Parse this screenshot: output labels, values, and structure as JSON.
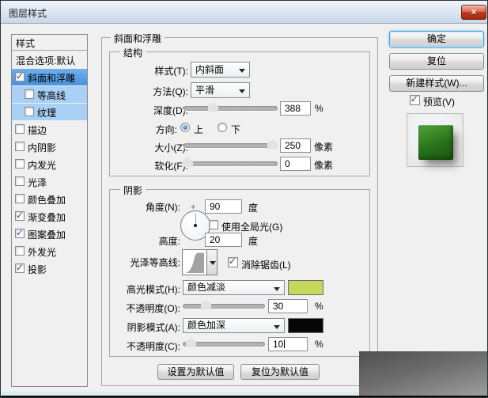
{
  "window": {
    "title": "图层样式",
    "close_glyph": "×"
  },
  "sidebar": {
    "header": "样式",
    "items": [
      {
        "label": "混合选项:默认",
        "checked": null,
        "state": "normal"
      },
      {
        "label": "斜面和浮雕",
        "checked": true,
        "state": "selected"
      },
      {
        "label": "等高线",
        "checked": false,
        "state": "highlight-sub"
      },
      {
        "label": "纹理",
        "checked": false,
        "state": "highlight-sub"
      },
      {
        "label": "描边",
        "checked": false,
        "state": "normal"
      },
      {
        "label": "内阴影",
        "checked": false,
        "state": "normal"
      },
      {
        "label": "内发光",
        "checked": false,
        "state": "normal"
      },
      {
        "label": "光泽",
        "checked": false,
        "state": "normal"
      },
      {
        "label": "颜色叠加",
        "checked": false,
        "state": "normal"
      },
      {
        "label": "渐变叠加",
        "checked": true,
        "state": "normal"
      },
      {
        "label": "图案叠加",
        "checked": true,
        "state": "normal"
      },
      {
        "label": "外发光",
        "checked": false,
        "state": "normal"
      },
      {
        "label": "投影",
        "checked": true,
        "state": "normal"
      }
    ]
  },
  "panel": {
    "legend": "斜面和浮雕",
    "structure": {
      "legend": "结构",
      "style_label": "样式(T):",
      "style_value": "内斜面",
      "method_label": "方法(Q):",
      "method_value": "平滑",
      "depth_label": "深度(D):",
      "depth_value": "388",
      "depth_unit": "%",
      "depth_slider_percent": 31,
      "direction_label": "方向:",
      "direction_up": "上",
      "direction_down": "下",
      "direction_selected": "上",
      "size_label": "大小(Z):",
      "size_value": "250",
      "size_unit": "像素",
      "size_slider_percent": 95,
      "soften_label": "软化(F):",
      "soften_value": "0",
      "soften_unit": "像素",
      "soften_slider_percent": 3
    },
    "shading": {
      "legend": "阴影",
      "angle_label": "角度(N):",
      "angle_value": "90",
      "angle_unit": "度",
      "use_global_light_label": "使用全局光(G)",
      "use_global_light_checked": false,
      "altitude_label": "高度:",
      "altitude_value": "20",
      "altitude_unit": "度",
      "gloss_contour_label": "光泽等高线:",
      "anti_alias_label": "消除锯齿(L)",
      "anti_alias_checked": true,
      "highlight_mode_label": "高光模式(H):",
      "highlight_mode_value": "颜色减淡",
      "highlight_color": "#c6d75b",
      "highlight_opacity_label": "不透明度(O):",
      "highlight_opacity_value": "30",
      "highlight_opacity_unit": "%",
      "highlight_opacity_slider_percent": 28,
      "shadow_mode_label": "阴影模式(A):",
      "shadow_mode_value": "颜色加深",
      "shadow_color": "#070707",
      "shadow_opacity_label": "不透明度(C):",
      "shadow_opacity_value": "10",
      "shadow_opacity_unit": "%",
      "shadow_opacity_slider_percent": 10
    },
    "footer": {
      "set_default": "设置为默认值",
      "reset_default": "复位为默认值"
    }
  },
  "actions": {
    "ok": "确定",
    "reset": "复位",
    "new_style": "新建样式(W)...",
    "preview_label": "预览(V)",
    "preview_checked": true
  }
}
